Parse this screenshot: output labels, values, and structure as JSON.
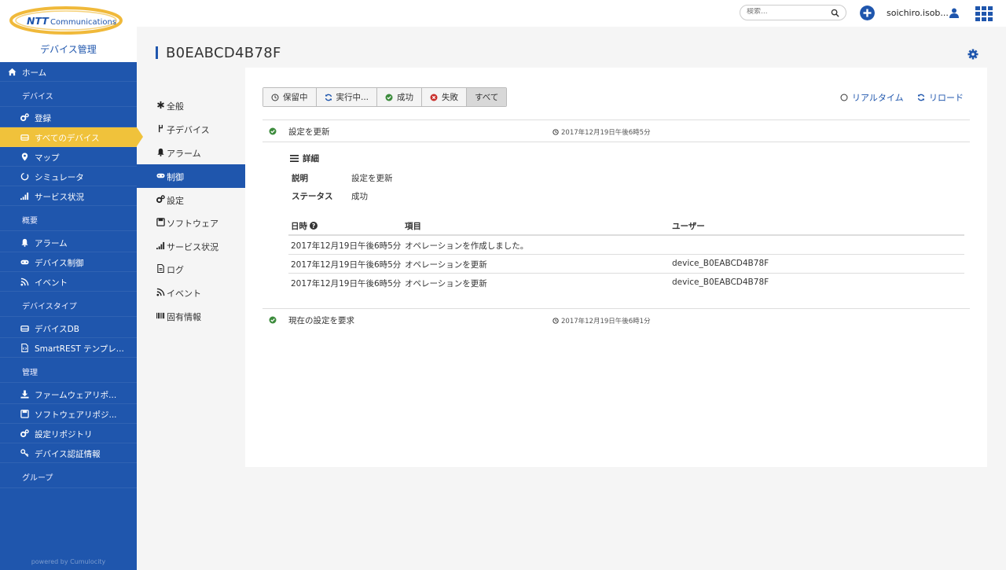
{
  "brand": {
    "logo_text": "NTT Communications",
    "app_title": "デバイス管理"
  },
  "topbar": {
    "search_placeholder": "検索...",
    "username": "soichiro.isob..."
  },
  "sidebar": {
    "home": "ホーム",
    "groups": [
      {
        "label": "デバイス"
      },
      {
        "label": "概要"
      },
      {
        "label": "デバイスタイプ"
      },
      {
        "label": "管理"
      }
    ],
    "items": [
      {
        "label": "登録"
      },
      {
        "label": "すべてのデバイス"
      },
      {
        "label": "マップ"
      },
      {
        "label": "シミュレータ"
      },
      {
        "label": "サービス状況"
      },
      {
        "label": "アラーム"
      },
      {
        "label": "デバイス制御"
      },
      {
        "label": "イベント"
      },
      {
        "label": "デバイスDB"
      },
      {
        "label": "SmartREST テンプレ..."
      },
      {
        "label": "ファームウェアリポ..."
      },
      {
        "label": "ソフトウェアリポジ..."
      },
      {
        "label": "設定リポジトリ"
      },
      {
        "label": "デバイス認証情報"
      }
    ],
    "group_label": "グループ",
    "powered_by": "powered by Cumulocity"
  },
  "page": {
    "title": "B0EABCD4B78F"
  },
  "subnav": [
    {
      "label": "全般"
    },
    {
      "label": "子デバイス"
    },
    {
      "label": "アラーム"
    },
    {
      "label": "制御"
    },
    {
      "label": "設定"
    },
    {
      "label": "ソフトウェア"
    },
    {
      "label": "サービス状況"
    },
    {
      "label": "ログ"
    },
    {
      "label": "イベント"
    },
    {
      "label": "固有情報"
    }
  ],
  "filters": [
    {
      "label": "保留中"
    },
    {
      "label": "実行中..."
    },
    {
      "label": "成功"
    },
    {
      "label": "失敗"
    },
    {
      "label": "すべて"
    }
  ],
  "actions": {
    "realtime": "リアルタイム",
    "reload": "リロード"
  },
  "operations": [
    {
      "title": "設定を更新",
      "time": "2017年12月19日午後6時5分"
    },
    {
      "title": "現在の設定を要求",
      "time": "2017年12月19日午後6時1分"
    }
  ],
  "detail": {
    "heading": "詳細",
    "description_key": "説明",
    "description_val": "設定を更新",
    "status_key": "ステータス",
    "status_val": "成功",
    "table": {
      "headers": [
        "日時",
        "項目",
        "ユーザー"
      ],
      "rows": [
        {
          "time": "2017年12月19日午後6時5分",
          "item": "オペレーションを作成しました。",
          "user": ""
        },
        {
          "time": "2017年12月19日午後6時5分",
          "item": "オペレーションを更新",
          "user": "device_B0EABCD4B78F"
        },
        {
          "time": "2017年12月19日午後6時5分",
          "item": "オペレーションを更新",
          "user": "device_B0EABCD4B78F"
        }
      ]
    }
  },
  "colors": {
    "primary": "#1f56ad",
    "active_nav": "#f0c23b",
    "success": "#3c8b3c",
    "error": "#c9302c"
  }
}
